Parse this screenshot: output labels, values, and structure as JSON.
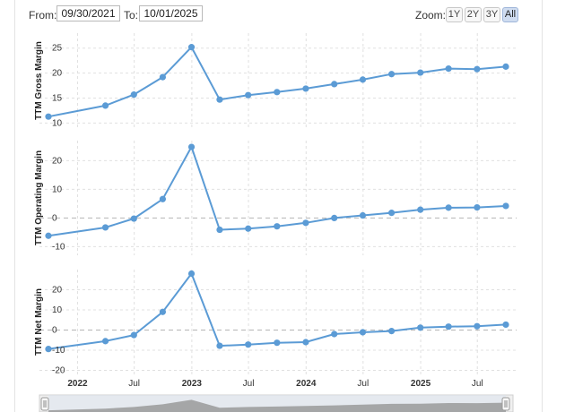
{
  "toolbar": {
    "from_label": "From:",
    "from_value": "09/30/2021",
    "to_label": "To:",
    "to_value": "10/01/2025",
    "zoom_label": "Zoom:",
    "zoom_options": [
      "1Y",
      "2Y",
      "3Y",
      "All"
    ],
    "zoom_selected": "All"
  },
  "colors": {
    "line": "#5b9bd5",
    "grid": "#e0e0e0",
    "zero_line": "#b5b5b5",
    "navigator_fill": "#9a9a9a"
  },
  "chart_data": {
    "type": "line",
    "x_axis_ticks": [
      "2022",
      "Jul",
      "2023",
      "Jul",
      "2024",
      "Jul",
      "2025",
      "Jul"
    ],
    "x": [
      "2021-09-30",
      "2021-12-31",
      "2022-03-31",
      "2022-06-30",
      "2022-09-30",
      "2022-12-31",
      "2023-03-31",
      "2023-06-30",
      "2023-09-30",
      "2023-12-31",
      "2024-03-31",
      "2024-06-30",
      "2024-09-30",
      "2024-12-31",
      "2025-03-31",
      "2025-06-30",
      "2025-09-30"
    ],
    "panels": [
      {
        "ylabel": "TTM Gross Margin",
        "ylim": [
          9,
          28
        ],
        "ticks": [
          10,
          15,
          20,
          25
        ],
        "zero_line": false,
        "values": [
          11.3,
          null,
          13.5,
          15.7,
          19.2,
          25.2,
          14.7,
          15.6,
          16.2,
          16.9,
          17.8,
          18.7,
          19.8,
          20.1,
          20.9,
          20.8,
          21.3
        ]
      },
      {
        "ylabel": "TTM Operating Margin",
        "ylim": [
          -13,
          27
        ],
        "ticks": [
          -10,
          0,
          10,
          20
        ],
        "zero_line": true,
        "values": [
          -6.2,
          null,
          -3.3,
          -0.2,
          6.6,
          24.8,
          -4.1,
          -3.7,
          -2.9,
          -1.7,
          0.0,
          0.9,
          1.8,
          2.9,
          3.6,
          3.7,
          4.2
        ]
      },
      {
        "ylabel": "TTM Net Margin",
        "ylim": [
          -22,
          30
        ],
        "ticks": [
          -20,
          -10,
          0,
          10,
          20
        ],
        "zero_line": true,
        "values": [
          -9.4,
          null,
          -5.5,
          -2.5,
          9.0,
          28.0,
          -7.8,
          -7.2,
          -6.3,
          -6.0,
          -2.0,
          -1.1,
          -0.5,
          1.2,
          1.7,
          1.9,
          2.7
        ]
      }
    ]
  }
}
